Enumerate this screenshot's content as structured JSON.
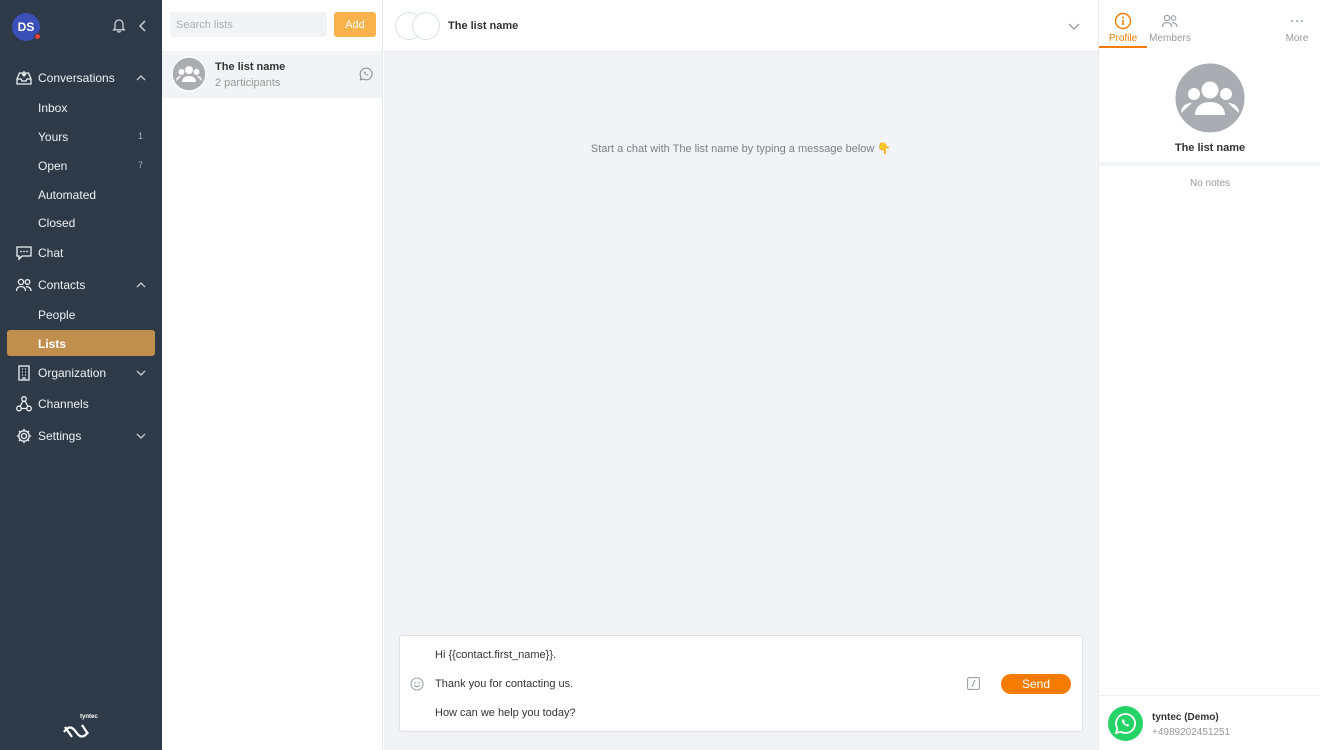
{
  "user": {
    "initials": "DS"
  },
  "sidebar": {
    "conversations": {
      "label": "Conversations",
      "items": [
        {
          "label": "Inbox",
          "count": ""
        },
        {
          "label": "Yours",
          "count": "1"
        },
        {
          "label": "Open",
          "count": "7"
        },
        {
          "label": "Automated",
          "count": ""
        },
        {
          "label": "Closed",
          "count": ""
        }
      ]
    },
    "chat": {
      "label": "Chat"
    },
    "contacts": {
      "label": "Contacts",
      "items": [
        {
          "label": "People"
        },
        {
          "label": "Lists"
        }
      ]
    },
    "organization": {
      "label": "Organization"
    },
    "channels": {
      "label": "Channels"
    },
    "settings": {
      "label": "Settings"
    },
    "brand": "tyntec"
  },
  "lists": {
    "search_placeholder": "Search lists",
    "add_label": "Add",
    "items": [
      {
        "title": "The list name",
        "subtitle": "2 participants"
      }
    ]
  },
  "chat": {
    "title": "The list name",
    "empty_message": "Start a chat with The list name by typing a message below 👇",
    "composer": {
      "lines": [
        "Hi {{contact.first_name}}.",
        "Thank you for contacting us.",
        "How can we help you today?"
      ],
      "send_label": "Send"
    }
  },
  "details": {
    "tabs": [
      {
        "label": "Profile"
      },
      {
        "label": "Members"
      },
      {
        "label": "More"
      }
    ],
    "name": "The list name",
    "notes": "No notes",
    "channel": {
      "name": "tyntec (Demo)",
      "number": "+4989202451251"
    }
  },
  "colors": {
    "sidebar_bg": "#2f3a48",
    "active_item": "#c08f4e",
    "accent": "#f57c00",
    "add_button": "#f9b24c",
    "whatsapp": "#25d366"
  }
}
